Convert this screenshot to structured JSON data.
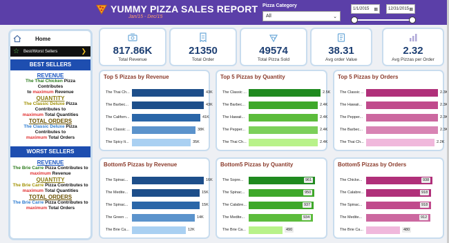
{
  "header": {
    "title": "YUMMY PIZZA SALES REPORT",
    "subtitle": "Jan/15 - Dec/15",
    "category_label": "Pizza Category",
    "category_value": "All",
    "date_start": "1/1/2015",
    "date_end": "12/31/2015"
  },
  "sidebar": {
    "home": "Home",
    "best_worst": "Best/Worst Sellers",
    "best_title": "BEST SELLERS",
    "worst_title": "WORST SELLERS",
    "best": {
      "revenue_kw": "REVENUE",
      "revenue_pizza": "The Thai Chicken",
      "revenue_text1": "Pizza Contributes",
      "revenue_to": "to",
      "revenue_max": "maximum",
      "revenue_metric": "Revenue",
      "quantity_kw": "QUANTITY",
      "quantity_pizza": "The Classic Deluxe",
      "quantity_text1": "Pizza Contributes to",
      "quantity_max": "maximum",
      "quantity_metric": "Total Quantities",
      "orders_kw": "TOTAL ORDERS",
      "orders_pizza": "The Classic Deluxe",
      "orders_text1": "Pizza Contributes to",
      "orders_max": "maximum",
      "orders_metric": "Total Orders"
    },
    "worst": {
      "revenue_kw": "REVENUE",
      "revenue_pizza": "The Brie Carre",
      "revenue_text1": "Pizza Contributes to",
      "revenue_max": "maximum",
      "revenue_metric": "Revenue",
      "quantity_kw": "QUANTITY",
      "quantity_pizza": "The Brie Carre",
      "quantity_text1": "Pizza Contributes to",
      "quantity_max": "maximum",
      "quantity_metric": "Total Quantities",
      "orders_kw": "TOTAL ORDERS",
      "orders_pizza": "The Brie Carre",
      "orders_text1": "Pizza Contributes to",
      "orders_max": "maximum",
      "orders_metric": "Total Orders"
    }
  },
  "kpis": [
    {
      "value": "817.86K",
      "label": "Total Revenue",
      "icon": "money-icon"
    },
    {
      "value": "21350",
      "label": "Total Order",
      "icon": "receipt-icon"
    },
    {
      "value": "49574",
      "label": "Total Pizza Sold",
      "icon": "pizza-box-icon"
    },
    {
      "value": "38.31",
      "label": "Avg order Value",
      "icon": "clipboard-icon"
    },
    {
      "value": "2.32",
      "label": "Avg Pizzas per Order",
      "icon": "bar-chart-icon"
    }
  ],
  "chart_data": [
    {
      "type": "bar",
      "title": "Top 5 Pizzas by Revenue",
      "categories": [
        "The Thai Ch...",
        "The Barbec...",
        "The Californ...",
        "The Classic ...",
        "The Spicy It..."
      ],
      "values": [
        43000,
        43000,
        41000,
        38000,
        35000
      ],
      "labels": [
        "43K",
        "43K",
        "41K",
        "38K",
        "35K"
      ],
      "max": 43000,
      "colors": [
        "#1d4e8a",
        "#1d4e8a",
        "#2a66a8",
        "#5b93cc",
        "#a9d0f2"
      ]
    },
    {
      "type": "bar",
      "title": "Top 5 Pizzas by Quantity",
      "categories": [
        "The Classic ...",
        "The Barbec...",
        "The Hawaii...",
        "The Pepper...",
        "The Thai Ch..."
      ],
      "values": [
        2500,
        2400,
        2400,
        2400,
        2400
      ],
      "labels": [
        "2.5K",
        "2.4K",
        "2.4K",
        "2.4K",
        "2.4K"
      ],
      "max": 2500,
      "colors": [
        "#1f8a1f",
        "#3ea82a",
        "#5cbc3c",
        "#7cd05a",
        "#b8f28a"
      ]
    },
    {
      "type": "bar",
      "title": "Top 5 Pizzas by Orders",
      "categories": [
        "The Classic ...",
        "The Hawaii...",
        "The Pepper...",
        "The Barbec...",
        "The Thai Ch..."
      ],
      "values": [
        2300,
        2300,
        2300,
        2300,
        2200
      ],
      "labels": [
        "2.3K",
        "2.3K",
        "2.3K",
        "2.3K",
        "2.2K"
      ],
      "max": 2300,
      "colors": [
        "#b0307a",
        "#c04a8c",
        "#cc68a0",
        "#d884b4",
        "#f0b8dc"
      ]
    },
    {
      "type": "bar",
      "title": "Bottom5 Pizzas by Revenue",
      "categories": [
        "The Spinac...",
        "The Medite...",
        "The Spinac...",
        "The Green ...",
        "The Brie Ca..."
      ],
      "values": [
        16000,
        15000,
        15000,
        14000,
        12000
      ],
      "labels": [
        "16K",
        "15K",
        "15K",
        "14K",
        "12K"
      ],
      "max": 16000,
      "colors": [
        "#1d4e8a",
        "#1d4e8a",
        "#2a66a8",
        "#5b93cc",
        "#a9d0f2"
      ]
    },
    {
      "type": "bar",
      "title": "Bottom5 Pizzas by Quantity",
      "categories": [
        "The Sopre...",
        "The Spinac...",
        "The Calabre...",
        "The Medite...",
        "The Brie Ca..."
      ],
      "values": [
        961,
        950,
        937,
        934,
        490
      ],
      "labels": [
        "961",
        "950",
        "937",
        "934",
        "490"
      ],
      "max": 961,
      "colors": [
        "#1f8a1f",
        "#3ea82a",
        "#3ea82a",
        "#5cbc3c",
        "#b8f28a"
      ]
    },
    {
      "type": "bar",
      "title": "Bottom5 Pizzas by Orders",
      "categories": [
        "The Chicke...",
        "The Calabre...",
        "The Spinac...",
        "The Medite...",
        "The Brie Ca..."
      ],
      "values": [
        938,
        918,
        918,
        912,
        480
      ],
      "labels": [
        "938",
        "918",
        "918",
        "912",
        "480"
      ],
      "max": 938,
      "colors": [
        "#b0307a",
        "#b0307a",
        "#c04a8c",
        "#cc68a0",
        "#f0b8dc"
      ]
    }
  ]
}
